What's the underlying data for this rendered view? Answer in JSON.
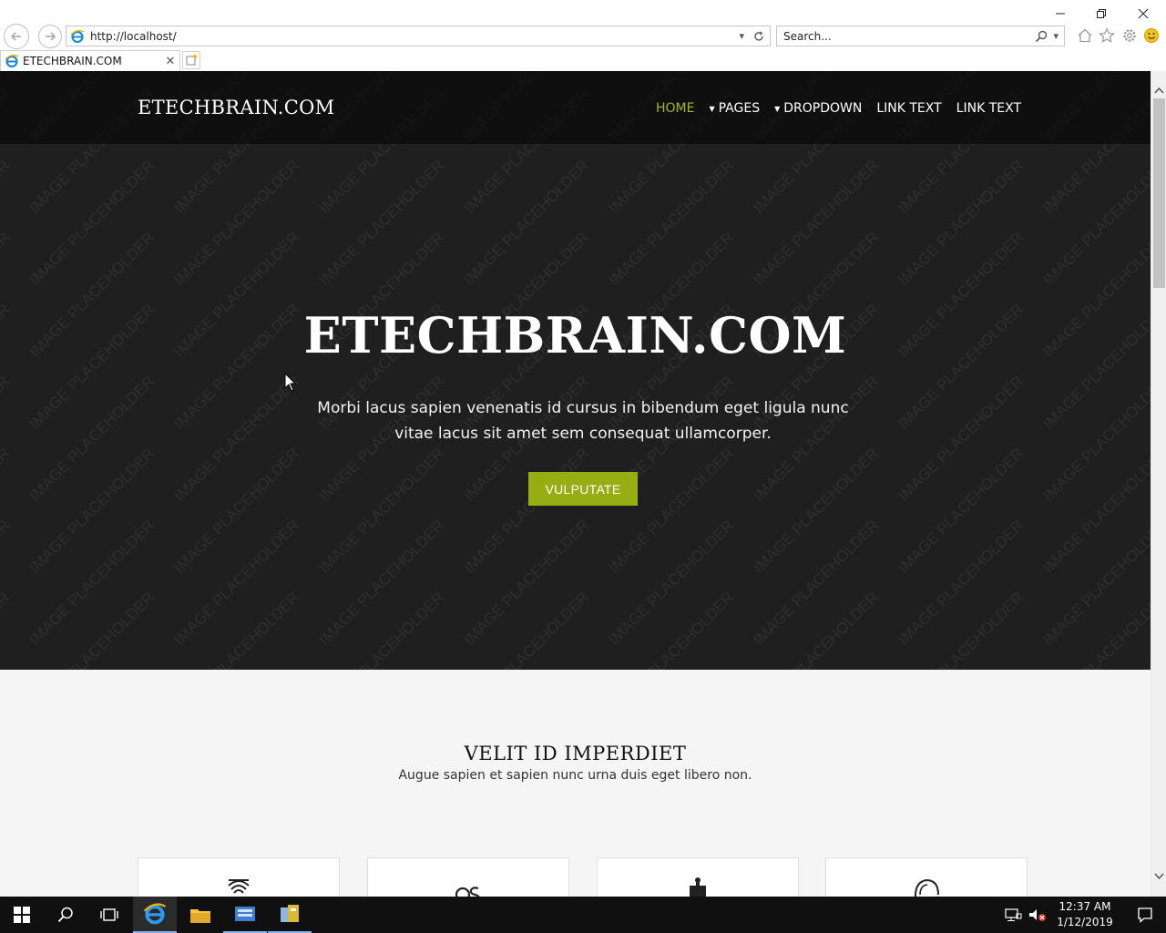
{
  "browser": {
    "address": "http://localhost/",
    "search_placeholder": "Search...",
    "tab_title": "ETECHBRAIN.COM"
  },
  "site": {
    "brand": "ETECHBRAIN.COM",
    "nav": [
      {
        "label": "HOME",
        "active": true,
        "dropdown": false
      },
      {
        "label": "PAGES",
        "active": false,
        "dropdown": true
      },
      {
        "label": "DROPDOWN",
        "active": false,
        "dropdown": true
      },
      {
        "label": "LINK TEXT",
        "active": false,
        "dropdown": false
      },
      {
        "label": "LINK TEXT",
        "active": false,
        "dropdown": false
      }
    ],
    "hero": {
      "title": "ETECHBRAIN.COM",
      "subtitle": "Morbi lacus sapien venenatis id cursus in bibendum eget ligula nunc vitae lacus sit amet sem consequat ullamcorper.",
      "button": "VULPUTATE",
      "watermark_text": "IMAGE PLACEHOLDER"
    },
    "section": {
      "title": "VELIT ID IMPERDIET",
      "subtitle": "Augue sapien et sapien nunc urna duis eget libero non."
    },
    "cards": [
      {
        "icon": "fingerprint-icon"
      },
      {
        "icon": "os-icon"
      },
      {
        "icon": "puzzle-icon"
      },
      {
        "icon": "brain-icon"
      }
    ]
  },
  "taskbar": {
    "time": "12:37 AM",
    "date": "1/12/2019"
  },
  "colors": {
    "accent": "#97ad14",
    "active_nav": "#a3b820",
    "hero_bg": "#1f1f1f"
  }
}
